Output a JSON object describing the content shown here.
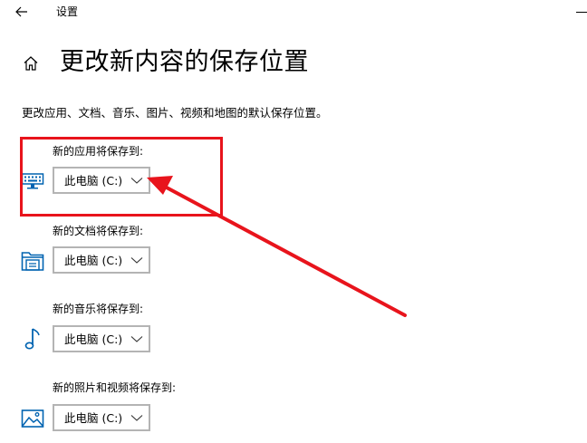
{
  "window": {
    "title": "设置",
    "back_icon": "back-arrow-icon",
    "minimize_icon": "minimize-icon"
  },
  "header": {
    "home_icon": "home-icon",
    "title": "更改新内容的保存位置"
  },
  "description": "更改应用、文档、音乐、图片、视频和地图的默认保存位置。",
  "settings": [
    {
      "label": "新的应用将保存到:",
      "value": "此电脑 (C:)",
      "icon": "apps-icon"
    },
    {
      "label": "新的文档将保存到:",
      "value": "此电脑 (C:)",
      "icon": "documents-folder-icon"
    },
    {
      "label": "新的音乐将保存到:",
      "value": "此电脑 (C:)",
      "icon": "music-note-icon"
    },
    {
      "label": "新的照片和视频将保存到:",
      "value": "此电脑 (C:)",
      "icon": "pictures-icon"
    }
  ],
  "colors": {
    "icon_blue": "#0063b1",
    "annotation_red": "#e8141c",
    "dropdown_border": "#b4b4b4",
    "background": "#ffffff"
  }
}
